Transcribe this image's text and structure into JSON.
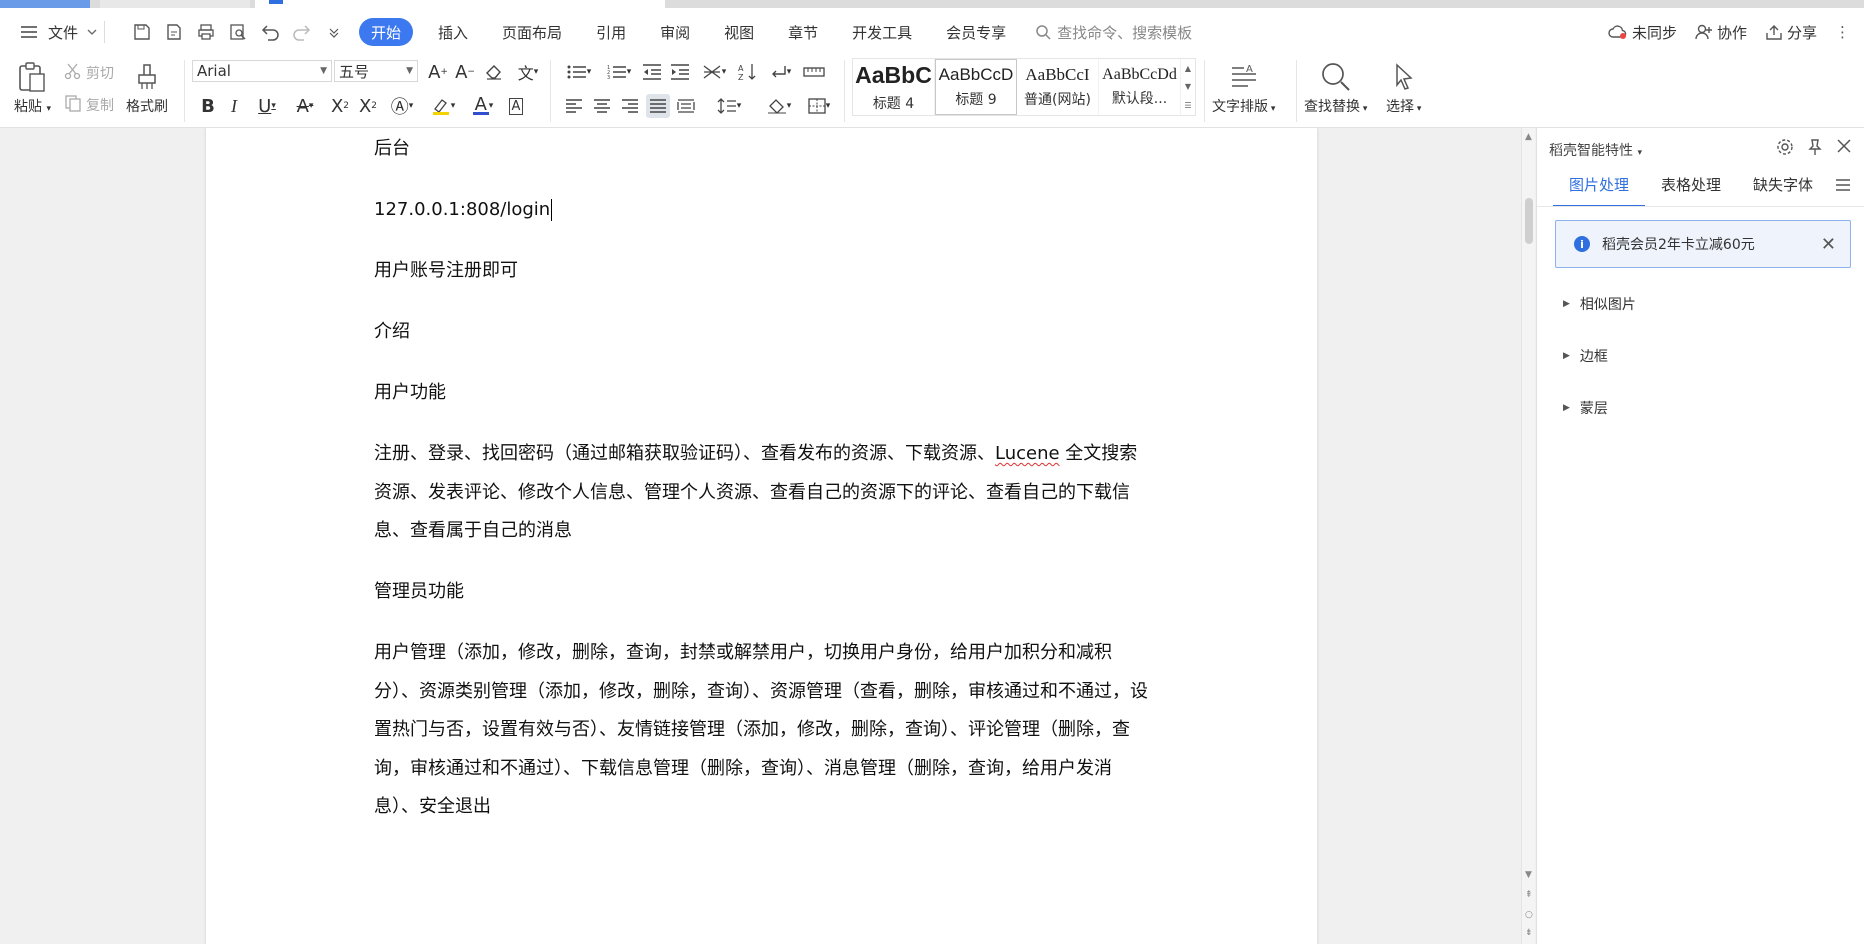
{
  "menubar": {
    "file_label": "文件",
    "tabs": [
      "开始",
      "插入",
      "页面布局",
      "引用",
      "审阅",
      "视图",
      "章节",
      "开发工具",
      "会员专享"
    ],
    "search_placeholder": "查找命令、搜索模板",
    "sync_label": "未同步",
    "collab_label": "协作",
    "share_label": "分享"
  },
  "ribbon": {
    "paste_label": "粘贴",
    "cut_label": "剪切",
    "copy_label": "复制",
    "format_painter_label": "格式刷",
    "font_name": "Arial",
    "font_size": "五号",
    "styles": [
      {
        "preview": "AaBbC",
        "label": "标题 4"
      },
      {
        "preview": "AaBbCcD",
        "label": "标题 9"
      },
      {
        "preview": "AaBbCcI",
        "label": "普通(网站)"
      },
      {
        "preview": "AaBbCcDd",
        "label": "默认段..."
      }
    ],
    "text_layout_label": "文字排版",
    "find_replace_label": "查找替换",
    "select_label": "选择"
  },
  "document": {
    "p1": "后台",
    "p2": "127.0.0.1:808/login",
    "p3": "用户账号注册即可",
    "p4": "介绍",
    "p5": "用户功能",
    "p6a": "注册、登录、找回密码（通过邮箱获取验证码）、查看发布的资源、下载资源、",
    "p6_lucene": "Lucene",
    "p6b": " 全文搜索资源、发表评论、修改个人信息、管理个人资源、查看自己的资源下的评论、查看自己的下载信息、查看属于自己的消息",
    "p7": "管理员功能",
    "p8": "用户管理（添加，修改，删除，查询，封禁或解禁用户，切换用户身份，给用户加积分和减积分）、资源类别管理（添加，修改，删除，查询）、资源管理（查看，删除，审核通过和不通过，设置热门与否，设置有效与否）、友情链接管理（添加，修改，删除，查询）、评论管理（删除，查询，审核通过和不通过）、下载信息管理（删除，查询）、消息管理（删除，查询，给用户发消息）、安全退出"
  },
  "panel": {
    "title": "稻壳智能特性",
    "tabs": [
      "图片处理",
      "表格处理",
      "缺失字体"
    ],
    "notice": "稻壳会员2年卡立减60元",
    "items": [
      "相似图片",
      "边框",
      "蒙层"
    ]
  },
  "colors": {
    "accent": "#3c78f0",
    "highlight_yellow": "#f5d300",
    "font_red": "#e02020",
    "font_blue": "#2f4fd0"
  }
}
